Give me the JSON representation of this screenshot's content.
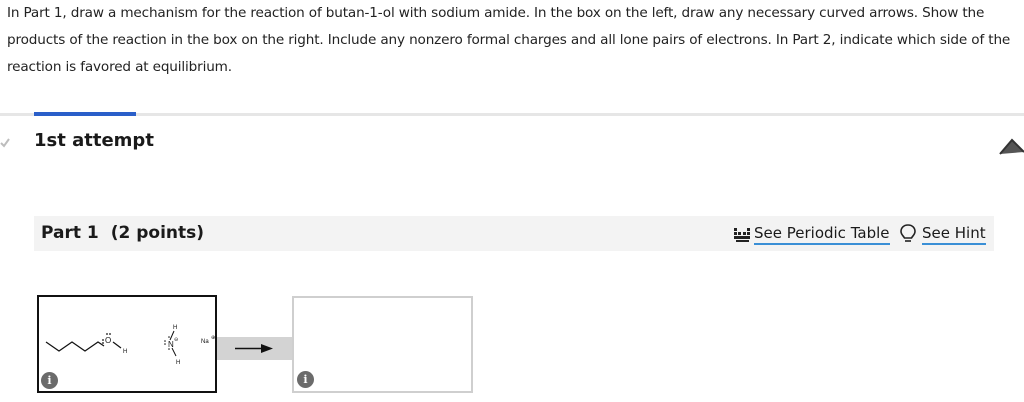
{
  "question": {
    "prompt": "In Part 1, draw a mechanism for the reaction of butan-1-ol with sodium amide. In the box on the left, draw any necessary curved arrows. Show the products of the reaction in the box on the right. Include any nonzero formal charges and all lone pairs of electrons. In Part 2, indicate which side of the reaction is favored at equilibrium."
  },
  "attempt": {
    "title": "1st attempt"
  },
  "part": {
    "title": "Part 1",
    "points": "(2 points)",
    "periodic_label": "See Periodic Table",
    "hint_label": "See Hint"
  },
  "reactants": {
    "oxygen": "O",
    "hydrogen_oh": "H",
    "nitrogen": "N",
    "h_top": "H",
    "h_bottom": "H",
    "sodium": "Na",
    "neg_charge": "⊖",
    "pos_charge": "⊕"
  },
  "icons": {
    "info": "i",
    "info_name": "info-icon",
    "periodic_name": "periodic-table-icon",
    "hint_name": "lightbulb-icon",
    "check_name": "check-icon",
    "collapse_name": "chevron-up-icon"
  },
  "colors": {
    "accent": "#2a5fc9",
    "link_underline": "#3a8fd6"
  }
}
